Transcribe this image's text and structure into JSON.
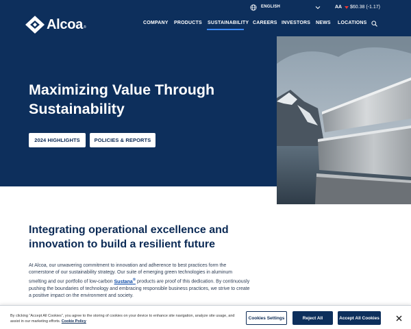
{
  "util": {
    "language": "ENGLISH",
    "ticker": "AA",
    "price": "$60.38 (-1.17)"
  },
  "brand": {
    "name": "Alcoa",
    "reg": "®"
  },
  "nav": {
    "items": [
      "COMPANY",
      "PRODUCTS",
      "SUSTAINABILITY",
      "CAREERS",
      "INVESTORS",
      "NEWS",
      "LOCATIONS"
    ],
    "active": "SUSTAINABILITY"
  },
  "hero": {
    "title": "Maximizing Value Through Sustainability",
    "buttons": [
      "2024 HIGHLIGHTS",
      "POLICIES & REPORTS"
    ]
  },
  "content": {
    "heading": "Integrating operational excellence and innovation to build a resilient future",
    "para_before": "At Alcoa, our unwavering commitment to innovation and adherence to best practices form the cornerstone of our sustainability strategy. Our suite of emerging green technologies in aluminum smelting and our portfolio of low-carbon ",
    "link": "Sustana",
    "link_sup": "®",
    "para_after": " products are proof of this dedication. By continuously pushing the boundaries of technology and embracing responsible business practices, we strive to create a positive impact on the environment and society."
  },
  "cookie": {
    "text": "By clicking “Accept All Cookies”, you agree to the storing of cookies on your device to enhance site navigation, analyze site usage, and assist in our marketing efforts.",
    "policy_link": "Cookie Policy",
    "settings": "Cookies Settings",
    "reject": "Reject All",
    "accept": "Accept All Cookies"
  },
  "colors": {
    "hero_bg": "#0d2f5c",
    "accent": "#3d8bfd",
    "ticker_down": "#e53935"
  }
}
